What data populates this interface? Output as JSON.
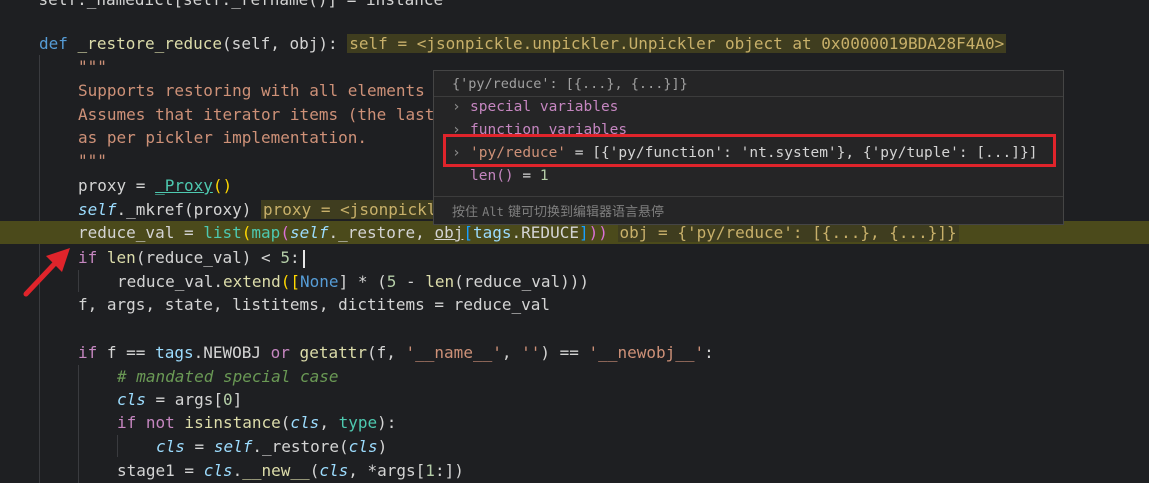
{
  "code": {
    "line0": "    self._namedict[self._refname()] = instance",
    "def_kw": "def",
    "def_name": "_restore_reduce",
    "def_params_a": "(self, obj):",
    "def_inline": "self = <jsonpickle.unpickler.Unpickler object at 0x0000019BDA28F4A0>",
    "doc_open": "\"\"\"",
    "doc1": "Supports restoring with all elements",
    "doc2": "Assumes that iterator items (the last",
    "doc3": "as per pickler implementation.",
    "doc_close": "\"\"\"",
    "proxy_line_a": "proxy = ",
    "proxy_call": "_Proxy",
    "proxy_parens": "()",
    "mkref_self": "self",
    "mkref_rest": "._mkref(proxy)",
    "mkref_inline": "proxy = <jsonpickl",
    "rv_a": "reduce_val = ",
    "rv_list": "list",
    "rv_b": "(",
    "rv_map": "map",
    "rv_c": "(",
    "rv_self": "self",
    "rv_d": "._restore, ",
    "rv_obj": "obj",
    "rv_e": "[",
    "rv_tags": "tags",
    "rv_f": ".REDUCE",
    "rv_g": "]",
    "rv_h": "))",
    "rv_inline": "obj = {'py/reduce': [{...}, {...}]}",
    "if_kw": "if",
    "if_len": "len",
    "if_rest": "(reduce_val) < ",
    "if_num": "5",
    "if_colon": ":",
    "ext_a": "reduce_val.",
    "ext_fn": "extend",
    "ext_b": "([",
    "ext_none": "None",
    "ext_c": "] * (",
    "ext_five": "5",
    "ext_d": " - ",
    "ext_len": "len",
    "ext_e": "(reduce_val)))",
    "unpack": "f, args, state, listitems, dictitems = reduce_val",
    "if2_kw": "if",
    "if2_a": " f == ",
    "if2_tags": "tags",
    "if2_b": ".NEWOBJ ",
    "if2_or": "or",
    "if2_getattr": " getattr",
    "if2_c": "(f, ",
    "if2_s1": "'__name__'",
    "if2_d": ", ",
    "if2_s2": "''",
    "if2_e": ") == ",
    "if2_s3": "'__newobj__'",
    "if2_f": ":",
    "comment": "# mandated special case",
    "cls1_a": "cls",
    "cls1_b": " = args[",
    "cls1_num": "0",
    "cls1_c": "]",
    "ifnot_kw": "if not",
    "ifnot_fn": " isinstance",
    "ifnot_a": "(",
    "ifnot_cls": "cls",
    "ifnot_b": ", ",
    "ifnot_type": "type",
    "ifnot_c": "):",
    "cls2_a": "cls",
    "cls2_b": " = ",
    "cls2_self": "self",
    "cls2_c": "._restore(",
    "cls2_cls": "cls",
    "cls2_d": ")",
    "stage_a": "stage1 = ",
    "stage_cls": "cls",
    "stage_b": ".",
    "stage_new": "__new__",
    "stage_c": "(",
    "stage_cls2": "cls",
    "stage_d": ", *args[",
    "stage_num": "1",
    "stage_e": ":])"
  },
  "hover": {
    "title": "{'py/reduce': [{...}, {...}]}",
    "row1": "special variables",
    "row2": "function variables",
    "row3_key": "'py/reduce'",
    "row3_val": " = [{'py/function': 'nt.system'}, {'py/tuple': [...]}]",
    "row4_name": "len()",
    "row4_eq": " = ",
    "row4_num": "1",
    "foot_a": "按住",
    "foot_key": "Alt",
    "foot_b": "键可切换到编辑器语言悬停"
  },
  "icons": {
    "chevron": "chevron-right-icon",
    "annotation_arrow": "red-arrow-icon"
  },
  "colors": {
    "background": "#1e1f22",
    "highlight_line": "#4b4a1b",
    "annotation_red": "#e0242b"
  }
}
